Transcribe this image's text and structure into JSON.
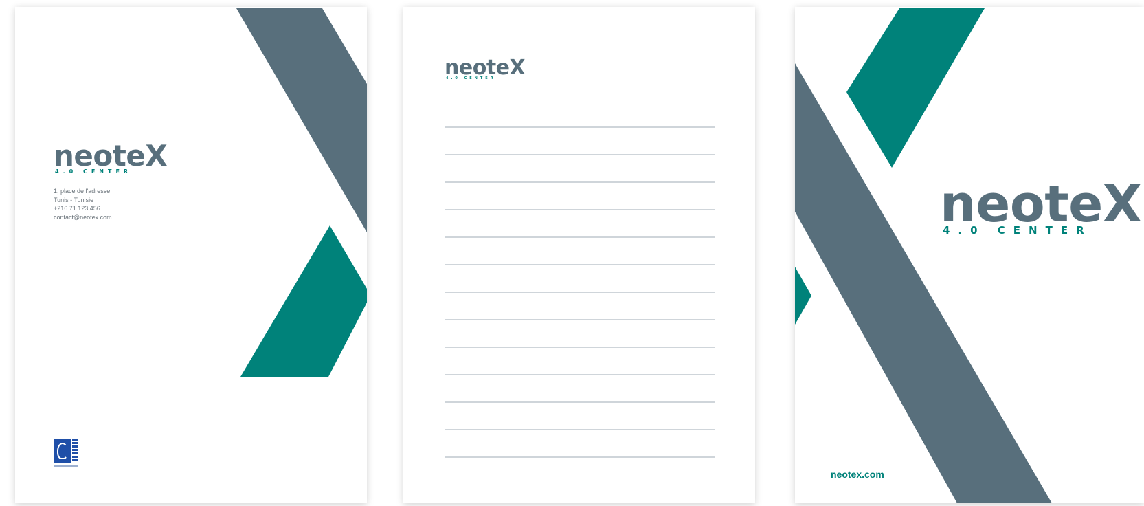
{
  "colors": {
    "slate": "#586f7c",
    "teal": "#00827a",
    "line": "#cfd5da",
    "paper": "#ffffff"
  },
  "brand": {
    "wordmark": "neote",
    "wordmark_x": "X",
    "tagline": "4.0 CENTER"
  },
  "letterhead": {
    "address_lines": [
      "1, place de l'adresse",
      "Tunis - Tunisie",
      "+216 71 123 456",
      "contact@neotex.com"
    ],
    "badge_icon": "institution-seal-icon"
  },
  "notepad": {
    "rule_count": 13
  },
  "cover": {
    "website": "neotex.com"
  }
}
